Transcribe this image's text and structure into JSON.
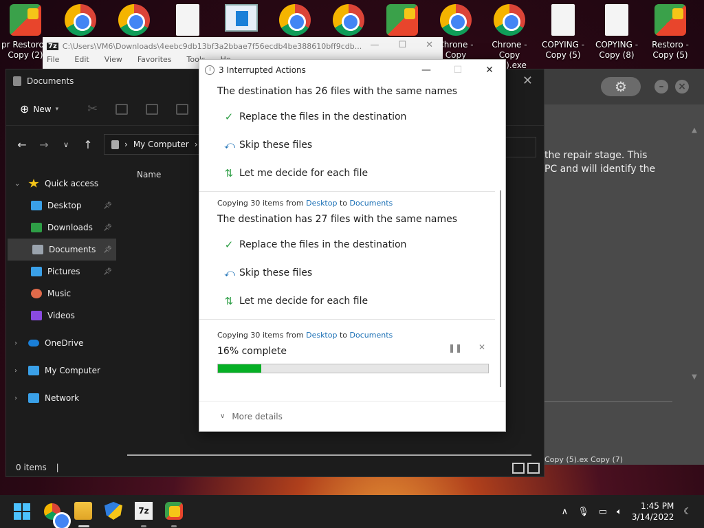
{
  "desktop": {
    "icons": [
      {
        "label": "pr Restoro -Copy (2)",
        "type": "restoro"
      },
      {
        "label": "",
        "type": "chrome"
      },
      {
        "label": "",
        "type": "chrome"
      },
      {
        "label": "",
        "type": "file"
      },
      {
        "label": "",
        "type": "app"
      },
      {
        "label": "",
        "type": "chrome"
      },
      {
        "label": "",
        "type": "chrome"
      },
      {
        "label": "",
        "type": "restoro"
      },
      {
        "label": "Chrone - Copy (8).exe",
        "type": "chrome"
      },
      {
        "label": "Chrone - Copy (12).exe",
        "type": "chrome"
      },
      {
        "label": "COPYING - Copy (5)",
        "type": "file"
      },
      {
        "label": "COPYING - Copy (8)",
        "type": "file"
      },
      {
        "label": "Restoro - Copy (5)",
        "type": "restoro"
      }
    ]
  },
  "sevenzip": {
    "badge": "7z",
    "path": "C:\\Users\\VM6\\Downloads\\4eebc9db13bf3a2bbae7f56ecdb4be388610bff9cdb...",
    "menu": [
      "File",
      "Edit",
      "View",
      "Favorites",
      "Tools",
      "He"
    ]
  },
  "explorer": {
    "title": "Documents",
    "new_label": "New",
    "address": "My Computer",
    "column_name": "Name",
    "status": "0 items",
    "sidebar": [
      {
        "label": "Quick access",
        "level": "top",
        "pin": false,
        "chev": "v"
      },
      {
        "label": "Desktop",
        "level": "sub",
        "pin": true
      },
      {
        "label": "Downloads",
        "level": "sub",
        "pin": true
      },
      {
        "label": "Documents",
        "level": "sub",
        "pin": true,
        "active": true
      },
      {
        "label": "Pictures",
        "level": "sub",
        "pin": true
      },
      {
        "label": "Music",
        "level": "sub",
        "pin": false
      },
      {
        "label": "Videos",
        "level": "sub",
        "pin": false
      },
      {
        "label": "OneDrive",
        "level": "top",
        "pin": false,
        "chev": ">"
      },
      {
        "label": "My Computer",
        "level": "top",
        "pin": false,
        "chev": ">"
      },
      {
        "label": "Network",
        "level": "top",
        "pin": false,
        "chev": ">"
      }
    ]
  },
  "restoro": {
    "text_line1": "the repair stage. This",
    "text_line2": "PC and will identify the",
    "footer": "Copy (5).ex     Copy (7)"
  },
  "dialog": {
    "title": "3 Interrupted Actions",
    "sections": [
      {
        "subtitle_prefix": "",
        "from": "",
        "to_word": "",
        "to": "",
        "heading": "The destination has 26 files with the same names",
        "options": [
          "Replace the files in the destination",
          "Skip these files",
          "Let me decide for each file"
        ]
      },
      {
        "subtitle_prefix": "Copying 30 items from",
        "from": "Desktop",
        "to_word": "to",
        "to": "Documents",
        "heading": "The destination has 27 files with the same names",
        "options": [
          "Replace the files in the destination",
          "Skip these files",
          "Let me decide for each file"
        ]
      }
    ],
    "progress": {
      "subtitle_prefix": "Copying 30 items from",
      "from": "Desktop",
      "to_word": "to",
      "to": "Documents",
      "label": "16% complete",
      "percent": 16
    },
    "more_details": "More details"
  },
  "taskbar": {
    "time": "1:45 PM",
    "date": "3/14/2022"
  },
  "colors": {
    "accent": "#1a6fb5",
    "progress": "#06b025",
    "check": "#2e9e46"
  }
}
